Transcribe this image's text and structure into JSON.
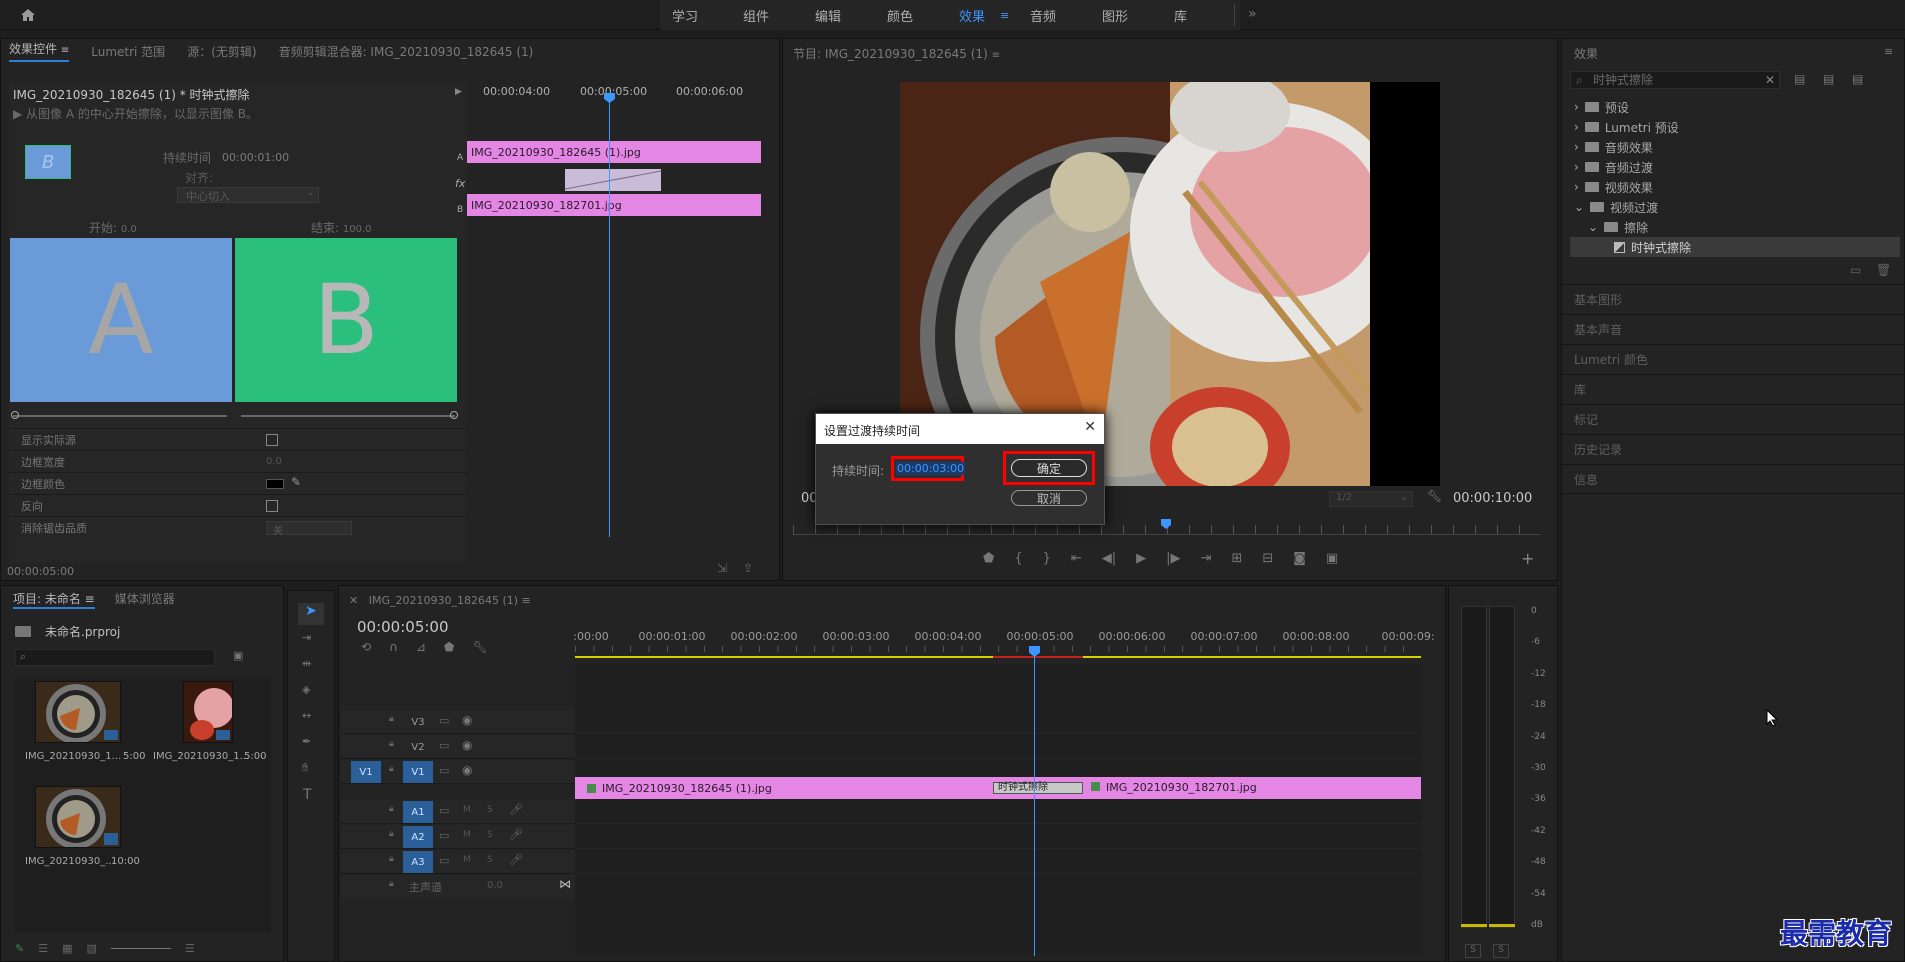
{
  "topbar": {
    "home_icon": "home-icon",
    "workspaces": [
      "学习",
      "组件",
      "编辑",
      "颜色",
      "效果",
      "音频",
      "图形",
      "库"
    ],
    "active_workspace": "效果",
    "more_icon": "double-chevron-right-icon"
  },
  "effect_controls": {
    "tabs": [
      "效果控件",
      "Lumetri 范围",
      "源：(无剪辑)",
      "音频剪辑混合器: IMG_20210930_182645 (1)"
    ],
    "clip_title": "IMG_20210930_182645 (1) * 时钟式擦除",
    "description": "从图像 A 的中心开始擦除，以显示图像 B。",
    "duration_label": "持续时间",
    "duration_value": "00:00:01:00",
    "align_label": "对齐:",
    "align_value": "中心切入",
    "start_label": "开始:",
    "start_value": "0.0",
    "end_label": "结束:",
    "end_value": "100.0",
    "preview_a": "A",
    "preview_b": "B",
    "props": [
      {
        "label": "显示实际源",
        "value": ""
      },
      {
        "label": "边框宽度",
        "value": "0.0"
      },
      {
        "label": "边框颜色",
        "value": ""
      },
      {
        "label": "反向",
        "value": ""
      },
      {
        "label": "消除锯齿品质",
        "value": "关"
      }
    ],
    "timecode": "00:00:05:00",
    "mini_ruler": [
      "00:00:04:00",
      "00:00:05:00",
      "00:00:06:00"
    ],
    "clip_a": "IMG_20210930_182645 (1).jpg",
    "clip_b": "IMG_20210930_182701.jpg",
    "label_a": "A",
    "label_b": "B",
    "label_fx": "fx"
  },
  "program": {
    "title": "节目: IMG_20210930_182645 (1)",
    "timecode_left": "00",
    "zoom": "1/2",
    "timecode_right": "00:00:10:00"
  },
  "dialog": {
    "title": "设置过渡持续时间",
    "duration_label": "持续时间:",
    "duration_value": "00:00:03:00",
    "ok_label": "确定",
    "cancel_label": "取消"
  },
  "effects_panel": {
    "title": "效果",
    "search_value": "时钟式擦除",
    "tree": [
      {
        "label": "预设",
        "level": 0,
        "open": false
      },
      {
        "label": "Lumetri 预设",
        "level": 0,
        "open": false
      },
      {
        "label": "音频效果",
        "level": 0,
        "open": false
      },
      {
        "label": "音频过渡",
        "level": 0,
        "open": false
      },
      {
        "label": "视频效果",
        "level": 0,
        "open": false
      },
      {
        "label": "视频过渡",
        "level": 0,
        "open": true
      },
      {
        "label": "擦除",
        "level": 1,
        "open": true
      },
      {
        "label": "时钟式擦除",
        "level": 2,
        "open": false
      }
    ],
    "sections": [
      "基本图形",
      "基本声音",
      "Lumetri 颜色",
      "库",
      "标记",
      "历史记录",
      "信息"
    ]
  },
  "project": {
    "tabs": [
      "项目: 未命名",
      "媒体浏览器"
    ],
    "file_name": "未命名.prproj",
    "items": [
      {
        "name": "IMG_20210930_1...",
        "duration": "5:00"
      },
      {
        "name": "IMG_20210930_1...",
        "duration": "5:00"
      },
      {
        "name": "IMG_20210930_...",
        "duration": "10:00"
      }
    ]
  },
  "timeline": {
    "tab": "IMG_20210930_182645 (1)",
    "timecode": "00:00:05:00",
    "ruler": [
      ":00:00",
      "00:00:01:00",
      "00:00:02:00",
      "00:00:03:00",
      "00:00:04:00",
      "00:00:05:00",
      "00:00:06:00",
      "00:00:07:00",
      "00:00:08:00",
      "00:00:09:"
    ],
    "video_tracks": [
      "V3",
      "V2",
      "V1"
    ],
    "audio_tracks": [
      "A1",
      "A2",
      "A3"
    ],
    "source_v": "V1",
    "master": "主声道",
    "master_value": "0.0",
    "clip1": "IMG_20210930_182645 (1).jpg",
    "clip2": "IMG_20210930_182701.jpg",
    "transition": "时钟式擦除",
    "mute_label": "M",
    "solo_label": "S"
  },
  "meter": {
    "scale": [
      "0",
      "-6",
      "-12",
      "-18",
      "-24",
      "-30",
      "-36",
      "-42",
      "-48",
      "-54",
      "dB"
    ],
    "s_labels": [
      "S",
      "S"
    ]
  },
  "watermark": "最需教育",
  "colors": {
    "accent": "#2f7fd6",
    "clip": "#e486e4",
    "highlight_box": "#ff0000",
    "track_blue": "#2b5f9a",
    "preview_a": "#6a9ad8",
    "preview_b": "#2bbf7e"
  }
}
